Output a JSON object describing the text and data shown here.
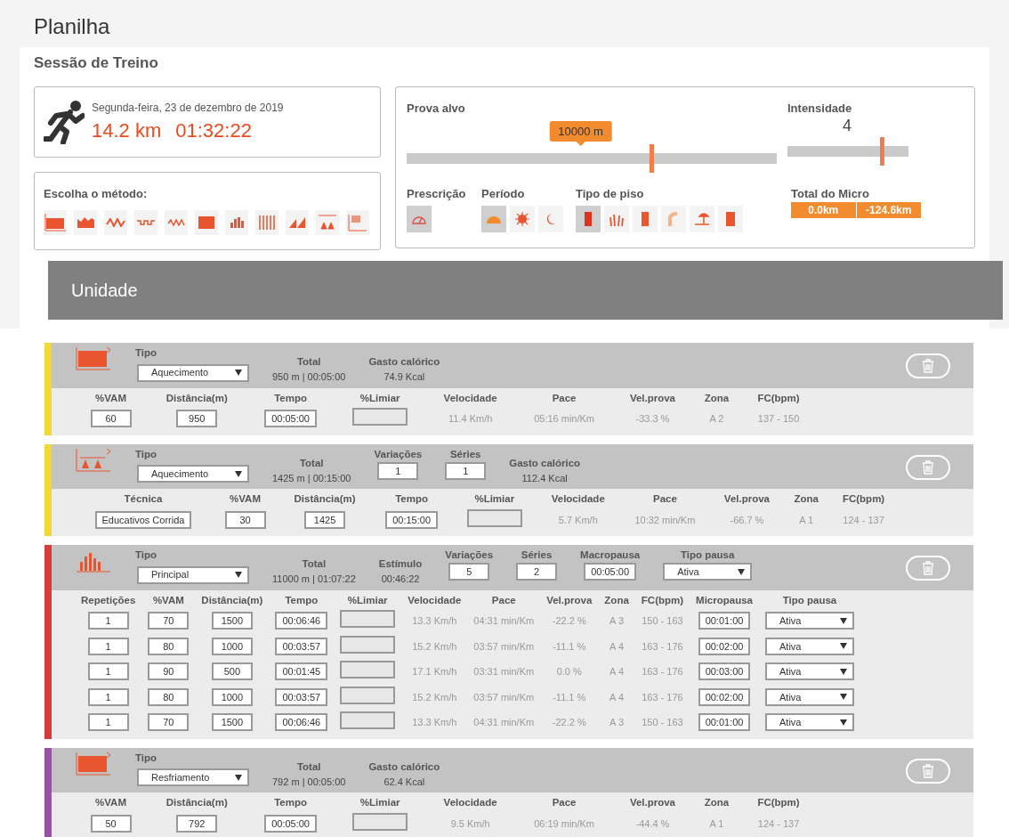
{
  "page_title": "Planilha",
  "section_title": "Sessão de Treino",
  "session": {
    "date": "Segunda-feira, 23 de dezembro de 2019",
    "distance": "14.2 km",
    "duration": "01:32:22"
  },
  "method": {
    "label": "Escolha o método:"
  },
  "target_race": {
    "label": "Prova alvo",
    "tooltip": "10000 m",
    "level": 0.66
  },
  "intensity": {
    "label": "Intensidade",
    "value": "4",
    "level": 0.78
  },
  "prescription": {
    "label": "Prescrição",
    "options": [
      {
        "selected": true
      }
    ]
  },
  "period": {
    "label": "Período",
    "options": [
      {
        "selected": true
      },
      {
        "selected": false
      },
      {
        "selected": false
      }
    ]
  },
  "floor_type": {
    "label": "Tipo de piso",
    "options": [
      {
        "selected": true
      },
      {
        "selected": false
      },
      {
        "selected": false
      },
      {
        "selected": false
      },
      {
        "selected": false
      },
      {
        "selected": false
      }
    ]
  },
  "micro_total": {
    "label": "Total do Micro",
    "values": [
      "0.0km",
      "-124.6km"
    ]
  },
  "unit_heading": "Unidade",
  "units": [
    {
      "color": "#f2d832",
      "kind": "block",
      "tipo": {
        "label": "Tipo",
        "value": "Aquecimento"
      },
      "fields": [
        {
          "label": "Total",
          "value": "950 m | 00:05:00",
          "kind": "text"
        },
        {
          "label": "Gasto calórico",
          "value": "74.9 Kcal",
          "kind": "text"
        }
      ],
      "columns": [
        "%VAM",
        "Distância(m)",
        "Tempo",
        "%Limiar",
        "Velocidade",
        "Pace",
        "Vel.prova",
        "Zona",
        "FC(bpm)"
      ],
      "rows": [
        [
          {
            "kind": "input",
            "value": "60"
          },
          {
            "kind": "input",
            "value": "950"
          },
          {
            "kind": "input",
            "value": "00:05:00"
          },
          {
            "kind": "blank"
          },
          {
            "kind": "text",
            "value": "11.4 Km/h"
          },
          {
            "kind": "text",
            "value": "05:16 min/Km"
          },
          {
            "kind": "text",
            "value": "-33.3 %"
          },
          {
            "kind": "text",
            "value": "A 2"
          },
          {
            "kind": "text",
            "value": "137 - 150"
          }
        ]
      ]
    },
    {
      "color": "#f2d832",
      "kind": "cones",
      "tipo": {
        "label": "Tipo",
        "value": "Aquecimento"
      },
      "fields": [
        {
          "label": "Total",
          "value": "1425 m | 00:15:00",
          "kind": "text"
        },
        {
          "label": "Variações",
          "value": "1",
          "kind": "input"
        },
        {
          "label": "Séries",
          "value": "1",
          "kind": "input"
        },
        {
          "label": "Gasto calórico",
          "value": "112.4 Kcal",
          "kind": "text"
        }
      ],
      "columns": [
        "Técnica",
        "%VAM",
        "Distância(m)",
        "Tempo",
        "%Limiar",
        "Velocidade",
        "Pace",
        "Vel.prova",
        "Zona",
        "FC(bpm)"
      ],
      "rows": [
        [
          {
            "kind": "input",
            "value": "Educativos Corrida"
          },
          {
            "kind": "input",
            "value": "30"
          },
          {
            "kind": "input",
            "value": "1425"
          },
          {
            "kind": "input",
            "value": "00:15:00"
          },
          {
            "kind": "blank"
          },
          {
            "kind": "text",
            "value": "5.7 Km/h"
          },
          {
            "kind": "text",
            "value": "10:32 min/Km"
          },
          {
            "kind": "text",
            "value": "-66.7 %"
          },
          {
            "kind": "text",
            "value": "A 1"
          },
          {
            "kind": "text",
            "value": "124 - 137"
          }
        ]
      ]
    },
    {
      "color": "#d63a3a",
      "kind": "bars",
      "tipo": {
        "label": "Tipo",
        "value": "Principal"
      },
      "fields": [
        {
          "label": "Total",
          "value": "11000 m | 01:07:22",
          "kind": "text"
        },
        {
          "label": "Estímulo",
          "value": "00:46:22",
          "kind": "text"
        },
        {
          "label": "Variações",
          "value": "5",
          "kind": "input"
        },
        {
          "label": "Séries",
          "value": "2",
          "kind": "input"
        },
        {
          "label": "Macropausa",
          "value": "00:05:00",
          "kind": "input"
        },
        {
          "label": "Tipo pausa",
          "value": "Ativa",
          "kind": "select"
        }
      ],
      "columns": [
        "Repetições",
        "%VAM",
        "Distância(m)",
        "Tempo",
        "%Limiar",
        "Velocidade",
        "Pace",
        "Vel.prova",
        "Zona",
        "FC(bpm)",
        "Micropausa",
        "Tipo pausa"
      ],
      "rows": [
        [
          {
            "kind": "input",
            "value": "1"
          },
          {
            "kind": "input",
            "value": "70"
          },
          {
            "kind": "input",
            "value": "1500"
          },
          {
            "kind": "input",
            "value": "00:06:46"
          },
          {
            "kind": "blank"
          },
          {
            "kind": "text",
            "value": "13.3 Km/h"
          },
          {
            "kind": "text",
            "value": "04:31 min/Km"
          },
          {
            "kind": "text",
            "value": "-22.2 %"
          },
          {
            "kind": "text",
            "value": "A 3"
          },
          {
            "kind": "text",
            "value": "150 - 163"
          },
          {
            "kind": "input",
            "value": "00:01:00"
          },
          {
            "kind": "select",
            "value": "Ativa"
          }
        ],
        [
          {
            "kind": "input",
            "value": "1"
          },
          {
            "kind": "input",
            "value": "80"
          },
          {
            "kind": "input",
            "value": "1000"
          },
          {
            "kind": "input",
            "value": "00:03:57"
          },
          {
            "kind": "blank"
          },
          {
            "kind": "text",
            "value": "15.2 Km/h"
          },
          {
            "kind": "text",
            "value": "03:57 min/Km"
          },
          {
            "kind": "text",
            "value": "-11.1 %"
          },
          {
            "kind": "text",
            "value": "A 4"
          },
          {
            "kind": "text",
            "value": "163 - 176"
          },
          {
            "kind": "input",
            "value": "00:02:00"
          },
          {
            "kind": "select",
            "value": "Ativa"
          }
        ],
        [
          {
            "kind": "input",
            "value": "1"
          },
          {
            "kind": "input",
            "value": "90"
          },
          {
            "kind": "input",
            "value": "500"
          },
          {
            "kind": "input",
            "value": "00:01:45"
          },
          {
            "kind": "blank"
          },
          {
            "kind": "text",
            "value": "17.1 Km/h"
          },
          {
            "kind": "text",
            "value": "03:31 min/Km"
          },
          {
            "kind": "text",
            "value": "0.0 %"
          },
          {
            "kind": "text",
            "value": "A 4"
          },
          {
            "kind": "text",
            "value": "163 - 176"
          },
          {
            "kind": "input",
            "value": "00:03:00"
          },
          {
            "kind": "select",
            "value": "Ativa"
          }
        ],
        [
          {
            "kind": "input",
            "value": "1"
          },
          {
            "kind": "input",
            "value": "80"
          },
          {
            "kind": "input",
            "value": "1000"
          },
          {
            "kind": "input",
            "value": "00:03:57"
          },
          {
            "kind": "blank"
          },
          {
            "kind": "text",
            "value": "15.2 Km/h"
          },
          {
            "kind": "text",
            "value": "03:57 min/Km"
          },
          {
            "kind": "text",
            "value": "-11.1 %"
          },
          {
            "kind": "text",
            "value": "A 4"
          },
          {
            "kind": "text",
            "value": "163 - 176"
          },
          {
            "kind": "input",
            "value": "00:02:00"
          },
          {
            "kind": "select",
            "value": "Ativa"
          }
        ],
        [
          {
            "kind": "input",
            "value": "1"
          },
          {
            "kind": "input",
            "value": "70"
          },
          {
            "kind": "input",
            "value": "1500"
          },
          {
            "kind": "input",
            "value": "00:06:46"
          },
          {
            "kind": "blank"
          },
          {
            "kind": "text",
            "value": "13.3 Km/h"
          },
          {
            "kind": "text",
            "value": "04:31 min/Km"
          },
          {
            "kind": "text",
            "value": "-22.2 %"
          },
          {
            "kind": "text",
            "value": "A 3"
          },
          {
            "kind": "text",
            "value": "150 - 163"
          },
          {
            "kind": "input",
            "value": "00:01:00"
          },
          {
            "kind": "select",
            "value": "Ativa"
          }
        ]
      ]
    },
    {
      "color": "#9b4fa8",
      "kind": "block",
      "tipo": {
        "label": "Tipo",
        "value": "Resfriamento"
      },
      "fields": [
        {
          "label": "Total",
          "value": "792 m | 00:05:00",
          "kind": "text"
        },
        {
          "label": "Gasto calórico",
          "value": "62.4 Kcal",
          "kind": "text"
        }
      ],
      "columns": [
        "%VAM",
        "Distância(m)",
        "Tempo",
        "%Limiar",
        "Velocidade",
        "Pace",
        "Vel.prova",
        "Zona",
        "FC(bpm)"
      ],
      "rows": [
        [
          {
            "kind": "input",
            "value": "50"
          },
          {
            "kind": "input",
            "value": "792"
          },
          {
            "kind": "input",
            "value": "00:05:00"
          },
          {
            "kind": "blank"
          },
          {
            "kind": "text",
            "value": "9.5 Km/h"
          },
          {
            "kind": "text",
            "value": "06:19 min/Km"
          },
          {
            "kind": "text",
            "value": "-44.4 %"
          },
          {
            "kind": "text",
            "value": "A 1"
          },
          {
            "kind": "text",
            "value": "124 - 137"
          }
        ]
      ]
    }
  ]
}
